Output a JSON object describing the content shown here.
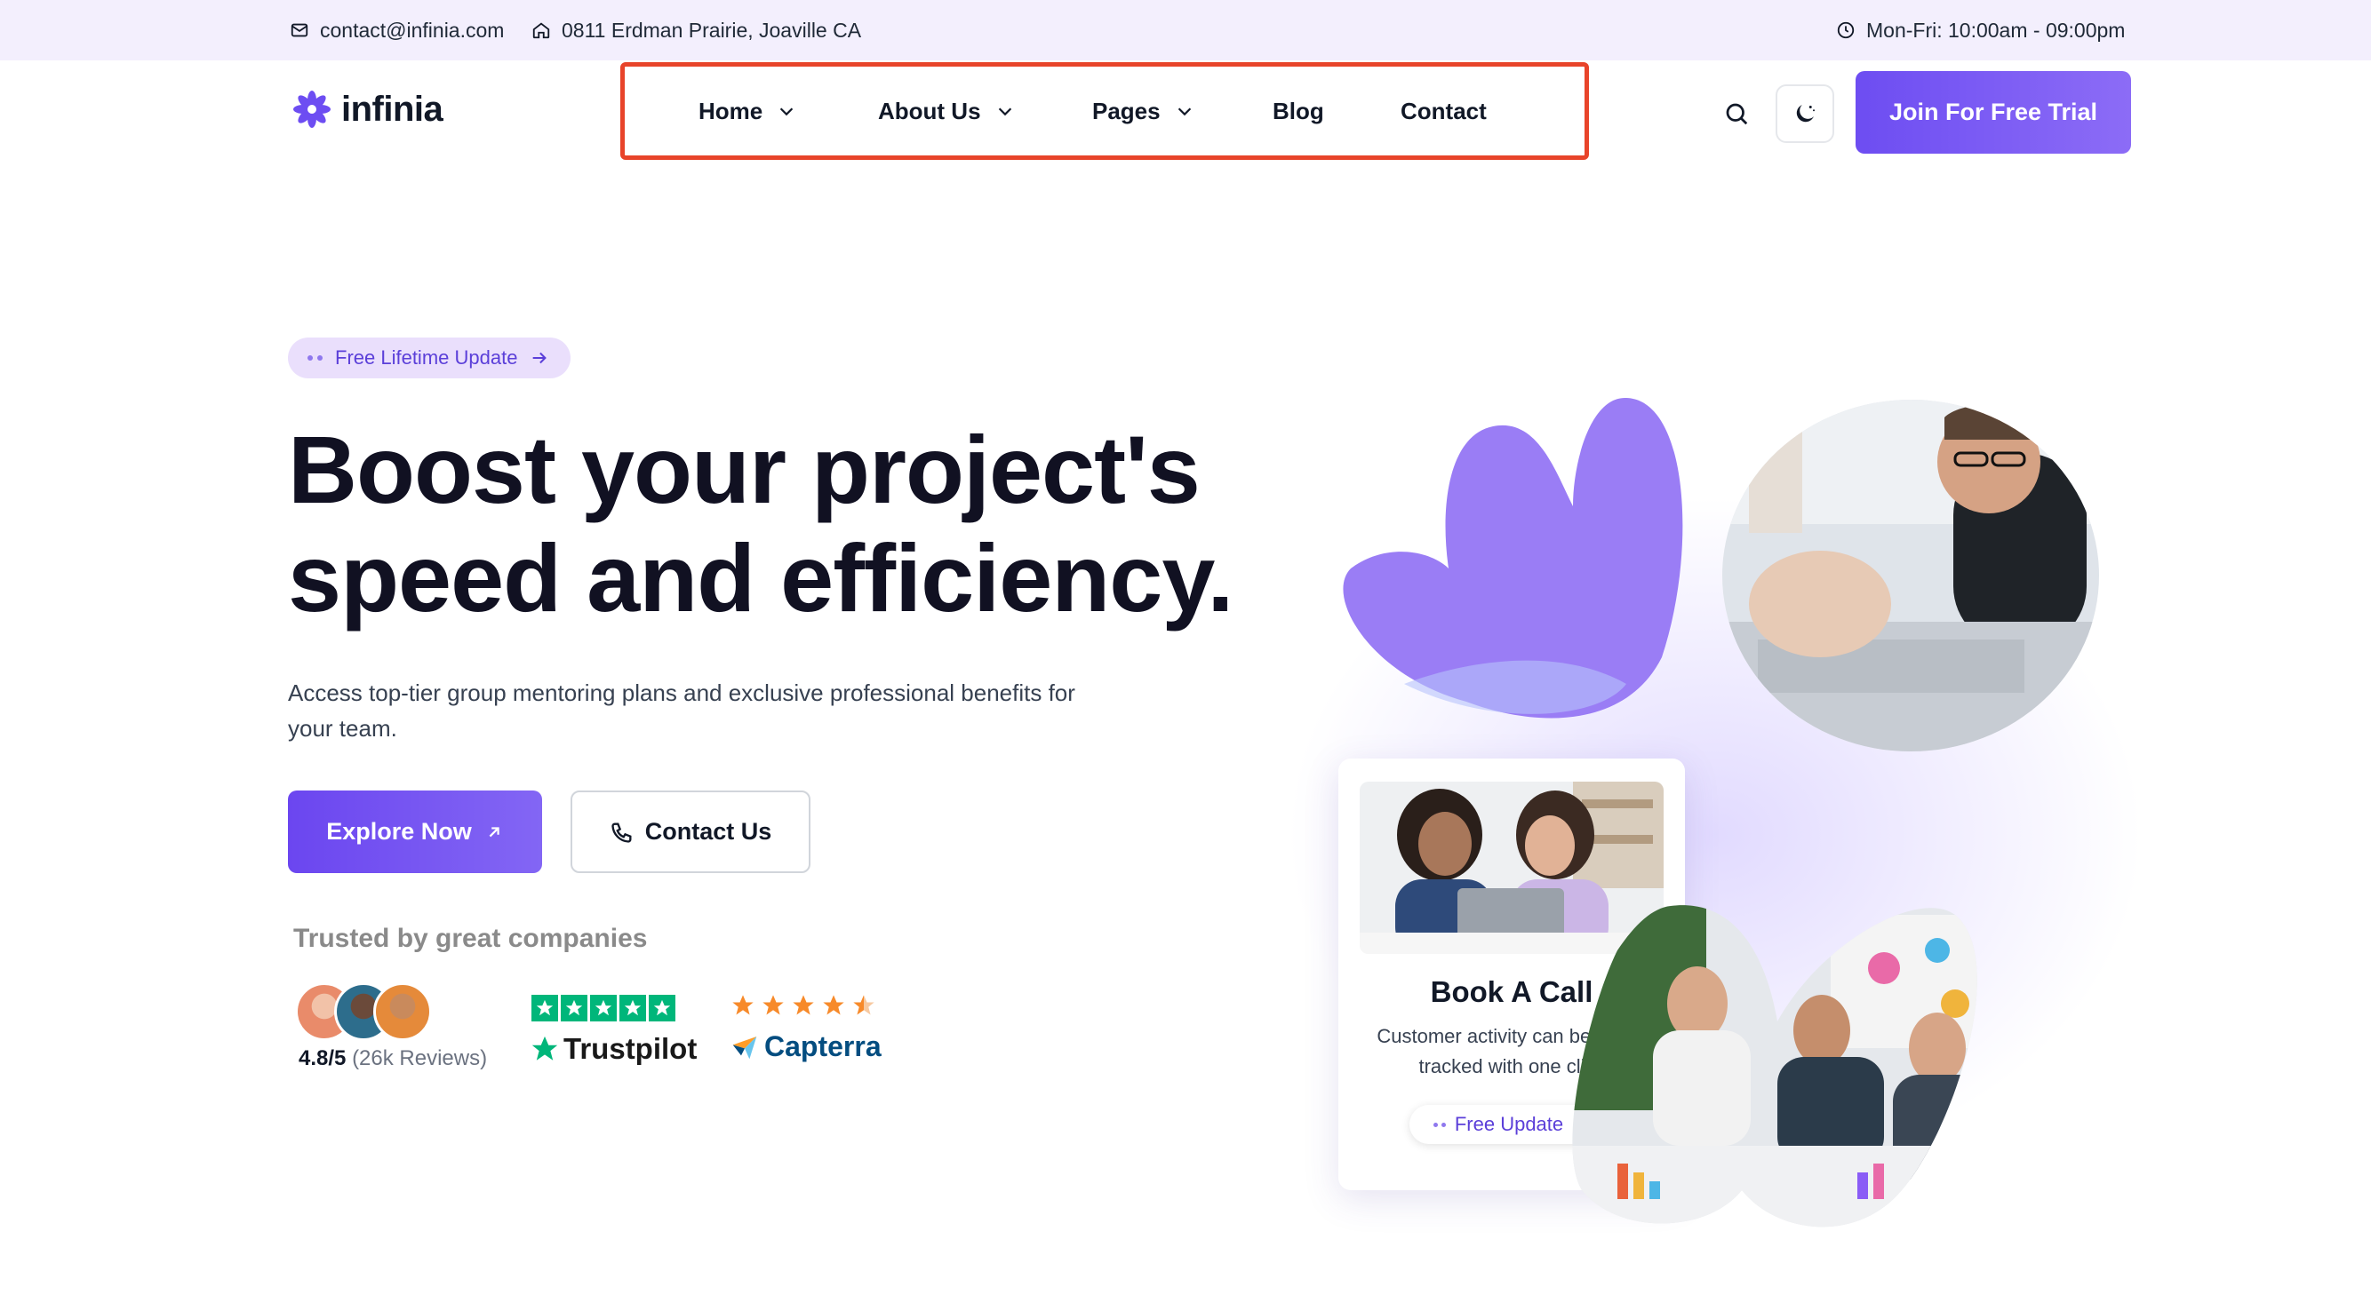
{
  "topbar": {
    "email": "contact@infinia.com",
    "address": "0811 Erdman Prairie, Joaville CA",
    "hours": "Mon-Fri: 10:00am - 09:00pm"
  },
  "header": {
    "logo_text": "infinia",
    "nav": [
      {
        "label": "Home",
        "has_dropdown": true
      },
      {
        "label": "About Us",
        "has_dropdown": true
      },
      {
        "label": "Pages",
        "has_dropdown": true
      },
      {
        "label": "Blog",
        "has_dropdown": false
      },
      {
        "label": "Contact",
        "has_dropdown": false
      }
    ],
    "cta_label": "Join For Free Trial",
    "highlight_color": "#e8442a"
  },
  "hero": {
    "pill_label": "Free Lifetime Update",
    "headline_line1": "Boost your project's",
    "headline_line2": "speed and efficiency.",
    "subtitle": "Access top-tier group mentoring plans and exclusive professional benefits for your team.",
    "explore_label": "Explore Now",
    "contact_label": "Contact Us",
    "trusted_label": "Trusted by great companies",
    "rating_value": "4.8/5",
    "rating_count": "(26k Reviews)",
    "trustpilot_name": "Trustpilot",
    "trustpilot_stars": 5,
    "capterra_name": "Capterra",
    "capterra_stars": 4.5,
    "accent_color": "#6d4df2"
  },
  "card": {
    "title": "Book A Call",
    "description": "Customer activity can be easily tracked with one click",
    "pill_label": "Free Update"
  }
}
